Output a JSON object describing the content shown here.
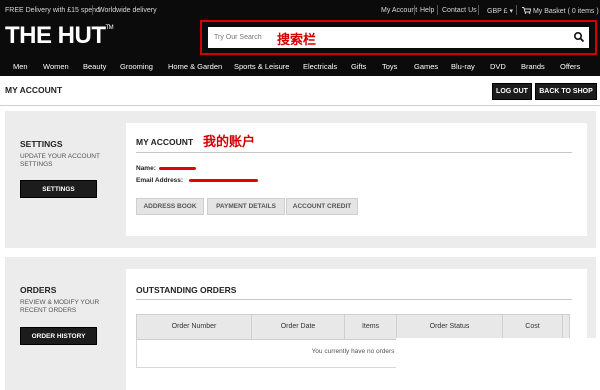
{
  "topbar": {
    "promo": "FREE Delivery with £15 spend",
    "worldwide": "Worldwide delivery",
    "my_account": "My Account",
    "help": "Help",
    "contact": "Contact Us",
    "currency": "GBP £",
    "basket": "My Basket ( 0 items )"
  },
  "logo": {
    "text": "THE HUT",
    "tm": "TM"
  },
  "search": {
    "placeholder": "Try Our Search",
    "annotation": "搜索栏"
  },
  "nav": [
    "Men",
    "Women",
    "Beauty",
    "Grooming",
    "Home & Garden",
    "Sports & Leisure",
    "Electricals",
    "Gifts",
    "Toys",
    "Games",
    "Blu-ray",
    "DVD",
    "Brands",
    "Offers"
  ],
  "page": {
    "title": "MY ACCOUNT",
    "logout": "LOG OUT",
    "back": "BACK TO SHOP"
  },
  "settings": {
    "title": "SETTINGS",
    "desc": "UPDATE YOUR ACCOUNT SETTINGS",
    "button": "SETTINGS"
  },
  "account": {
    "title": "MY ACCOUNT",
    "annotation": "我的账户",
    "name_label": "Name:",
    "email_label": "Email Address:",
    "buttons": [
      "ADDRESS BOOK",
      "PAYMENT DETAILS",
      "ACCOUNT CREDIT"
    ]
  },
  "orders": {
    "title": "ORDERS",
    "desc": "REVIEW & MODIFY YOUR RECENT ORDERS",
    "button": "ORDER HISTORY",
    "panel_title": "OUTSTANDING ORDERS",
    "columns": [
      "Order Number",
      "Order Date",
      "Items",
      "Order Status",
      "Cost"
    ],
    "empty": "You currently have no orders"
  },
  "colors": {
    "header_bg": "#0b0b0b",
    "annotation_red": "#d40000",
    "section_bg": "#ececec"
  }
}
